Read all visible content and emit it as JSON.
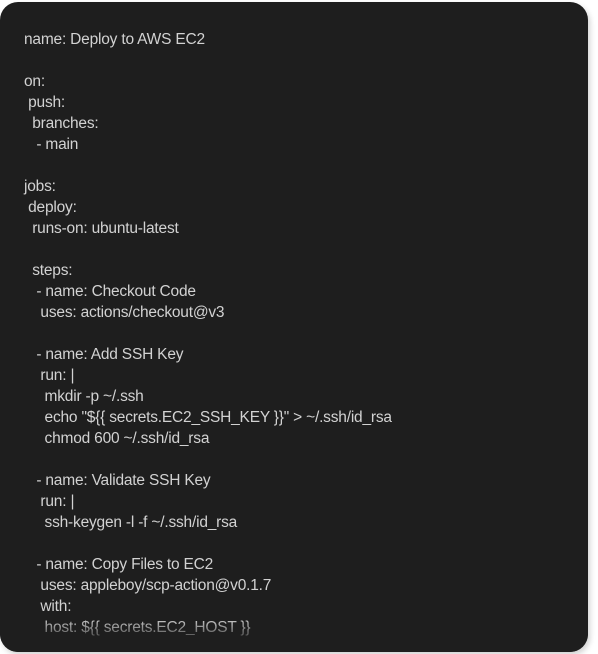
{
  "colors": {
    "background": "#1e1e1e",
    "text": "#d2d2d2"
  },
  "code": {
    "lines": [
      "name: Deploy to AWS EC2",
      "",
      "on:",
      " push:",
      "  branches:",
      "   - main",
      "",
      "jobs:",
      " deploy:",
      "  runs-on: ubuntu-latest",
      "",
      "  steps:",
      "   - name: Checkout Code",
      "    uses: actions/checkout@v3",
      "",
      "   - name: Add SSH Key",
      "    run: |",
      "     mkdir -p ~/.ssh",
      "     echo \"${{ secrets.EC2_SSH_KEY }}\" > ~/.ssh/id_rsa",
      "     chmod 600 ~/.ssh/id_rsa",
      "",
      "   - name: Validate SSH Key",
      "    run: |",
      "     ssh-keygen -l -f ~/.ssh/id_rsa",
      "",
      "   - name: Copy Files to EC2",
      "    uses: appleboy/scp-action@v0.1.7",
      "    with:",
      "     host: ${{ secrets.EC2_HOST }}"
    ]
  }
}
